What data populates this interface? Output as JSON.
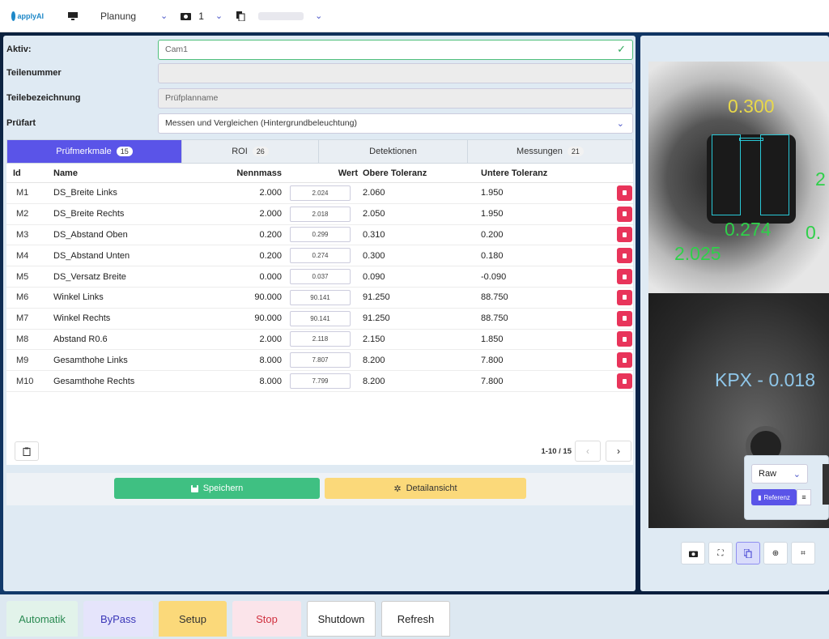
{
  "topbar": {
    "app_logo": "applyAI",
    "mode": "Planung",
    "camera_count": "1"
  },
  "form": {
    "aktiv_label": "Aktiv:",
    "aktiv_value": "Cam1",
    "teilenummer_label": "Teilenummer",
    "teilenummer_value": "",
    "teilebez_label": "Teilebezeichnung",
    "teilebez_placeholder": "Prüfplanname",
    "pruefart_label": "Prüfart",
    "pruefart_value": "Messen und Vergleichen (Hintergrundbeleuchtung)"
  },
  "tabs": [
    {
      "label": "Prüfmerkmale",
      "count": "15"
    },
    {
      "label": "ROI",
      "count": "26"
    },
    {
      "label": "Detektionen",
      "count": ""
    },
    {
      "label": "Messungen",
      "count": "21"
    }
  ],
  "table": {
    "headers": {
      "id": "Id",
      "name": "Name",
      "nenn": "Nennmass",
      "wert": "Wert",
      "ob": "Obere Toleranz",
      "un": "Untere Toleranz"
    },
    "rows": [
      {
        "id": "M1",
        "name": "DS_Breite Links",
        "nenn": "2.000",
        "wert": "2.024",
        "ob": "2.060",
        "un": "1.950"
      },
      {
        "id": "M2",
        "name": "DS_Breite Rechts",
        "nenn": "2.000",
        "wert": "2.018",
        "ob": "2.050",
        "un": "1.950"
      },
      {
        "id": "M3",
        "name": "DS_Abstand Oben",
        "nenn": "0.200",
        "wert": "0.299",
        "ob": "0.310",
        "un": "0.200"
      },
      {
        "id": "M4",
        "name": "DS_Abstand Unten",
        "nenn": "0.200",
        "wert": "0.274",
        "ob": "0.300",
        "un": "0.180"
      },
      {
        "id": "M5",
        "name": "DS_Versatz Breite",
        "nenn": "0.000",
        "wert": "0.037",
        "ob": "0.090",
        "un": "-0.090"
      },
      {
        "id": "M6",
        "name": "Winkel Links",
        "nenn": "90.000",
        "wert": "90.141",
        "ob": "91.250",
        "un": "88.750"
      },
      {
        "id": "M7",
        "name": "Winkel Rechts",
        "nenn": "90.000",
        "wert": "90.141",
        "ob": "91.250",
        "un": "88.750"
      },
      {
        "id": "M8",
        "name": "Abstand R0.6",
        "nenn": "2.000",
        "wert": "2.118",
        "ob": "2.150",
        "un": "1.850"
      },
      {
        "id": "M9",
        "name": "Gesamthohe Links",
        "nenn": "8.000",
        "wert": "7.807",
        "ob": "8.200",
        "un": "7.800"
      },
      {
        "id": "M10",
        "name": "Gesamthohe Rechts",
        "nenn": "8.000",
        "wert": "7.799",
        "ob": "8.200",
        "un": "7.800"
      }
    ],
    "pagination": "1-10 / 15",
    "prev": "‹",
    "next": "›"
  },
  "actions": {
    "save": "Speichern",
    "detail": "Detailansicht"
  },
  "camera": {
    "labels": {
      "top": "0.300",
      "right_top": "2",
      "mid": "0.274",
      "right_mid": "0.",
      "left": "2.025",
      "kpx": "KPX - 0.018"
    },
    "mode": "Raw",
    "referenz": "Referenz"
  },
  "bottom": {
    "automatik": "Automatik",
    "bypass": "ByPass",
    "setup": "Setup",
    "stop": "Stop",
    "shutdown": "Shutdown",
    "refresh": "Refresh"
  },
  "colors": {
    "accent": "#5a54e8",
    "save": "#3fc082",
    "detail": "#fbd97a",
    "delete": "#e8345a"
  }
}
